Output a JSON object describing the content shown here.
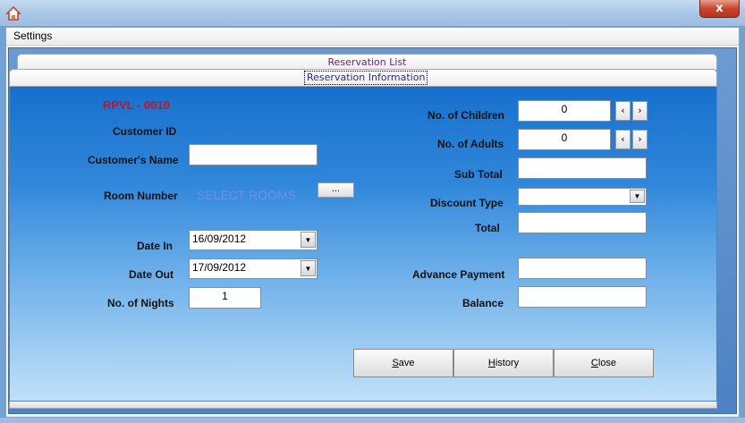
{
  "window": {
    "close_label": "x"
  },
  "menu": {
    "settings": "Settings"
  },
  "tabs": {
    "list": "Reservation List",
    "info": "Reservation Information"
  },
  "form": {
    "reservation_code": "RPVL - 0010",
    "labels": {
      "customer_id": "Customer ID",
      "customer_name": "Customer's Name",
      "room_number": "Room Number",
      "date_in": "Date In",
      "date_out": "Date Out",
      "nights": "No. of Nights",
      "children": "No. of Children",
      "adults": "No. of Adults",
      "sub_total": "Sub Total",
      "discount_type": "Discount Type",
      "total": "Total",
      "advance_payment": "Advance Payment",
      "balance": "Balance"
    },
    "values": {
      "customer_name": "",
      "select_rooms": "SELECT ROOMS",
      "room_button": "...",
      "date_in": "16/09/2012",
      "date_out": "17/09/2012",
      "nights": "1",
      "children": "0",
      "adults": "0",
      "sub_total": "",
      "discount_type": "",
      "total": "",
      "advance_payment": "",
      "balance": ""
    },
    "nav": {
      "prev": "‹",
      "next": "›"
    }
  },
  "buttons": {
    "save_u": "S",
    "save_rest": "ave",
    "history_u": "H",
    "history_rest": "istory",
    "close_u": "C",
    "close_rest": "lose"
  },
  "icons": {
    "app": "home-icon",
    "dropdown": "chevron-down-icon",
    "nav_prev": "chevron-left-icon",
    "nav_next": "chevron-right-icon"
  }
}
